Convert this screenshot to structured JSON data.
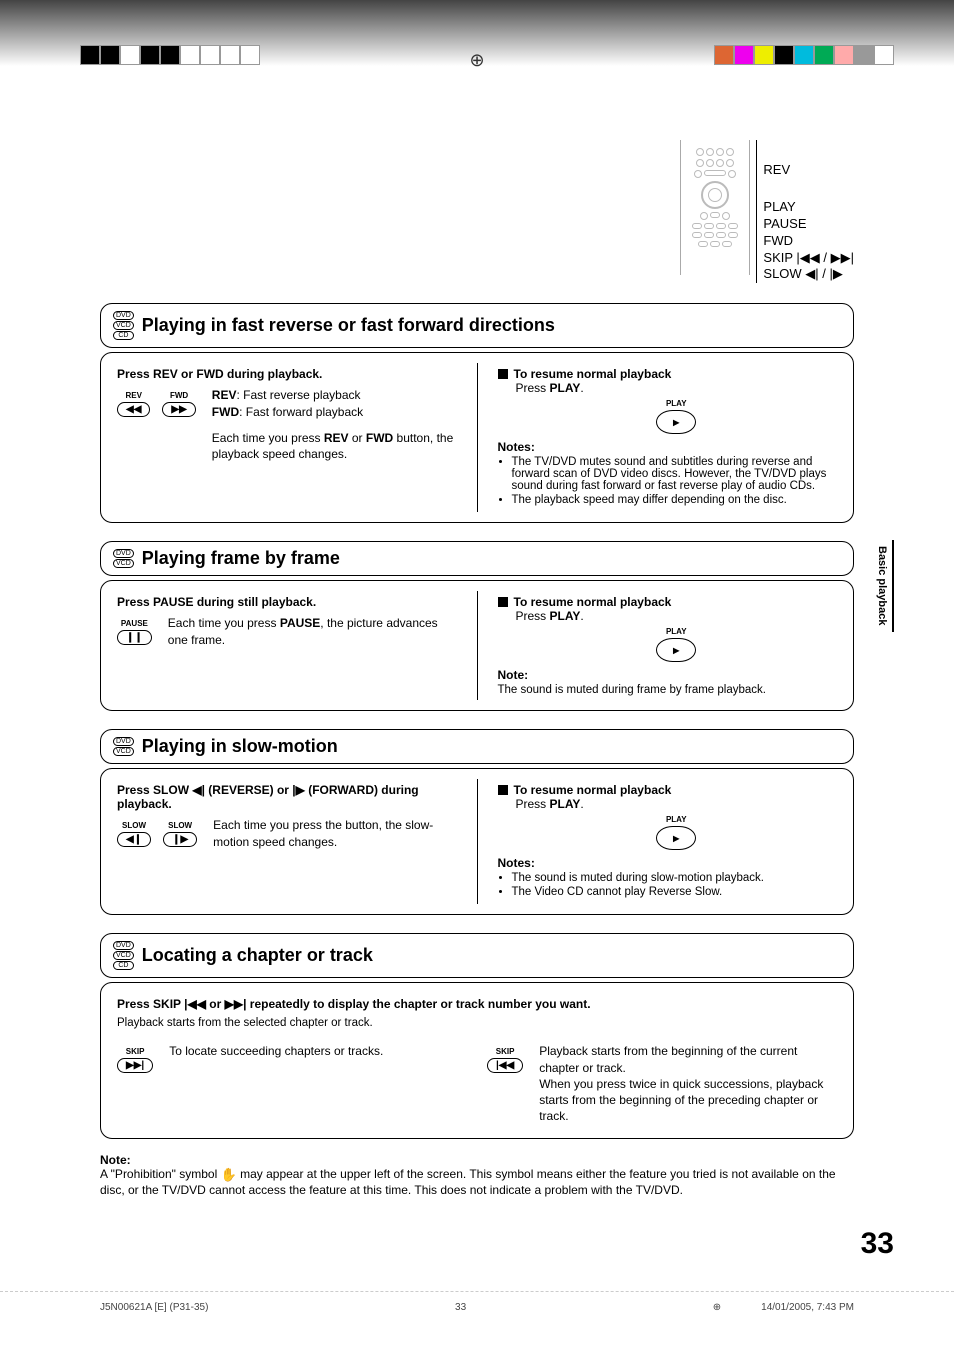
{
  "remote": {
    "labels": [
      "REV",
      "PLAY",
      "PAUSE",
      "FWD",
      "SKIP |◀◀ / ▶▶|",
      "SLOW ◀| / |▶"
    ]
  },
  "section1": {
    "badges": [
      "DVD",
      "VCD",
      "CD"
    ],
    "title": "Playing in fast reverse or fast forward directions",
    "instruction": "Press REV or FWD during playback.",
    "btn_rev_label": "REV",
    "btn_rev_glyph": "◀◀",
    "btn_fwd_label": "FWD",
    "btn_fwd_glyph": "▶▶",
    "line1a": "REV",
    "line1b": ": Fast reverse playback",
    "line2a": "FWD",
    "line2b": ": Fast forward playback",
    "line3_pre": "Each time you press ",
    "line3_b1": "REV",
    "line3_mid": " or ",
    "line3_b2": "FWD",
    "line3_post": " button, the playback speed changes.",
    "resume_title": "To resume normal playback",
    "resume_pre": "Press ",
    "resume_b": "PLAY",
    "resume_post": ".",
    "play_label": "PLAY",
    "play_glyph": "▶",
    "notes_label": "Notes:",
    "notes": [
      "The TV/DVD mutes sound and subtitles during reverse and forward scan of DVD video discs. However, the TV/DVD plays sound during fast forward or fast reverse play of audio CDs.",
      "The playback speed may differ depending on the disc."
    ]
  },
  "section2": {
    "badges": [
      "DVD",
      "VCD"
    ],
    "title": "Playing frame by frame",
    "instruction": "Press PAUSE during still playback.",
    "btn_pause_label": "PAUSE",
    "btn_pause_glyph": "❙❙",
    "line_pre": "Each time you press ",
    "line_b": "PAUSE",
    "line_post": ", the picture advances one frame.",
    "resume_title": "To resume normal playback",
    "resume_pre": "Press ",
    "resume_b": "PLAY",
    "resume_post": ".",
    "play_label": "PLAY",
    "play_glyph": "▶",
    "note_label": "Note:",
    "note_text": "The sound is muted during frame by frame playback."
  },
  "section3": {
    "badges": [
      "DVD",
      "VCD"
    ],
    "title": "Playing in slow-motion",
    "instruction": "Press SLOW ◀| (REVERSE) or |▶ (FORWARD) during playback.",
    "btn_slow_rev_label": "SLOW",
    "btn_slow_rev_glyph": "◀❙",
    "btn_slow_fwd_label": "SLOW",
    "btn_slow_fwd_glyph": "❙▶",
    "line": "Each time you press the button, the slow-motion speed changes.",
    "resume_title": "To resume normal playback",
    "resume_pre": "Press ",
    "resume_b": "PLAY",
    "resume_post": ".",
    "play_label": "PLAY",
    "play_glyph": "▶",
    "notes_label": "Notes:",
    "notes": [
      "The sound is muted during slow-motion playback.",
      "The Video CD cannot play Reverse Slow."
    ]
  },
  "section4": {
    "badges": [
      "DVD",
      "VCD",
      "CD"
    ],
    "title": "Locating a chapter or track",
    "instruction": "Press SKIP |◀◀ or ▶▶| repeatedly to display the chapter or track number you want.",
    "subline": "Playback starts from the selected chapter or track.",
    "btn_skip_next_label": "SKIP",
    "btn_skip_next_glyph": "▶▶|",
    "left_text": "To locate succeeding chapters or tracks.",
    "btn_skip_prev_label": "SKIP",
    "btn_skip_prev_glyph": "|◀◀",
    "right_text": "Playback starts from the beginning of the current chapter or track.\nWhen you press twice in quick successions, playback starts from the beginning of the preceding chapter or track."
  },
  "footnote": {
    "label": "Note:",
    "text_pre": "A \"Prohibition\" symbol ",
    "hand": "✋",
    "text_post": " may appear at the upper left of the screen. This symbol means either the feature you tried is not available on the disc, or the TV/DVD cannot access the feature at this time. This does not indicate a problem with the TV/DVD."
  },
  "side_tab": "Basic playback",
  "page_number": "33",
  "footer": {
    "doc_id": "J5N00621A [E] (P31-35)",
    "center": "33",
    "timestamp": "14/01/2005, 7:43 PM"
  },
  "colors": {
    "left": [
      "#000",
      "#000",
      "#fff",
      "#000",
      "#000",
      "#fff",
      "#fff",
      "#fff",
      "#fff"
    ],
    "right": [
      "#d63",
      "#e0e",
      "#ee0",
      "#000",
      "#0bd",
      "#0a5",
      "#faa",
      "#999",
      "#fff"
    ]
  }
}
